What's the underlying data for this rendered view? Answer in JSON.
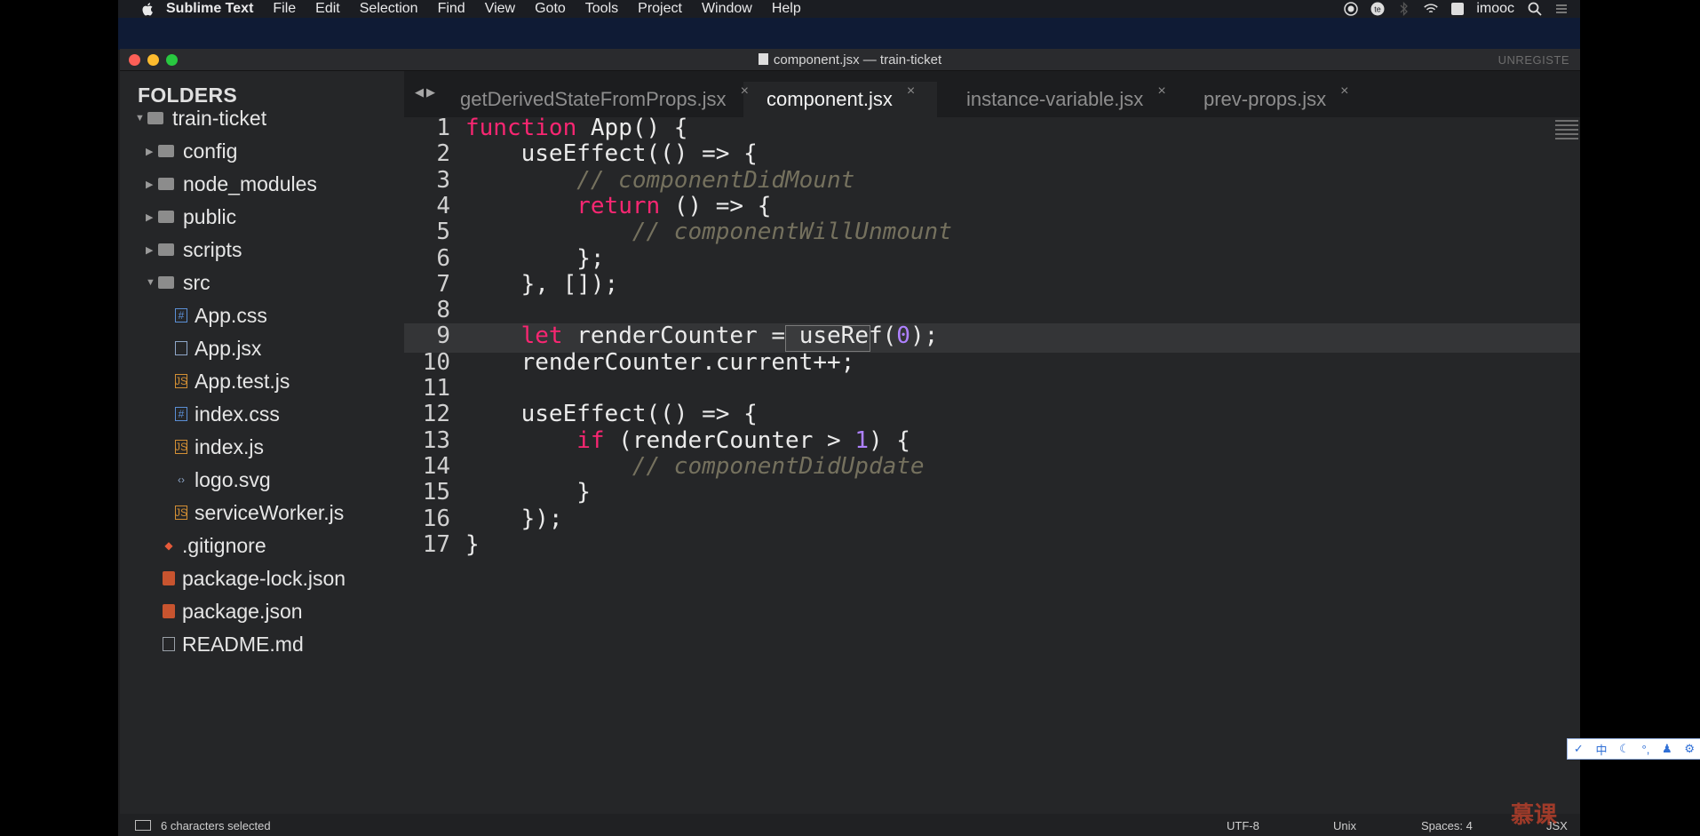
{
  "menubar": {
    "app_name": "Sublime Text",
    "items": [
      "File",
      "Edit",
      "Selection",
      "Find",
      "View",
      "Goto",
      "Tools",
      "Project",
      "Window",
      "Help"
    ],
    "user": "imooc",
    "input_badge": "A",
    "status_icons": [
      "record-icon",
      "te-icon",
      "bluetooth-icon",
      "wifi-icon",
      "input-source-icon",
      "spotlight-search-icon",
      "control-center-icon"
    ]
  },
  "window": {
    "title": "component.jsx — train-ticket",
    "unregistered": "UNREGISTE"
  },
  "sidebar": {
    "title": "FOLDERS",
    "tree": [
      {
        "label": "train-ticket",
        "kind": "folder",
        "expanded": true,
        "depth": 0
      },
      {
        "label": "config",
        "kind": "folder",
        "expanded": false,
        "depth": 1
      },
      {
        "label": "node_modules",
        "kind": "folder",
        "expanded": false,
        "depth": 1
      },
      {
        "label": "public",
        "kind": "folder",
        "expanded": false,
        "depth": 1
      },
      {
        "label": "scripts",
        "kind": "folder",
        "expanded": false,
        "depth": 1
      },
      {
        "label": "src",
        "kind": "folder",
        "expanded": true,
        "depth": 1
      },
      {
        "label": "App.css",
        "kind": "css",
        "depth": 2
      },
      {
        "label": "App.jsx",
        "kind": "jsx",
        "depth": 2
      },
      {
        "label": "App.test.js",
        "kind": "js",
        "depth": 2
      },
      {
        "label": "index.css",
        "kind": "css",
        "depth": 2
      },
      {
        "label": "index.js",
        "kind": "js",
        "depth": 2
      },
      {
        "label": "logo.svg",
        "kind": "svg",
        "depth": 2
      },
      {
        "label": "serviceWorker.js",
        "kind": "js",
        "depth": 2
      },
      {
        "label": ".gitignore",
        "kind": "git",
        "depth": 1
      },
      {
        "label": "package-lock.json",
        "kind": "json",
        "depth": 1
      },
      {
        "label": "package.json",
        "kind": "json",
        "depth": 1
      },
      {
        "label": "README.md",
        "kind": "md",
        "depth": 1
      }
    ]
  },
  "tabs": [
    {
      "label": "getDerivedStateFromProps.jsx",
      "active": false
    },
    {
      "label": "component.jsx",
      "active": true
    },
    {
      "label": "instance-variable.jsx",
      "active": false
    },
    {
      "label": "prev-props.jsx",
      "active": false
    }
  ],
  "editor": {
    "active_line": 9,
    "lines": [
      [
        {
          "t": "function",
          "c": "kw"
        },
        {
          "t": " App() {",
          "c": "pl"
        }
      ],
      [
        {
          "t": "    useEffect(() => {",
          "c": "pl"
        }
      ],
      [
        {
          "t": "        // componentDidMount",
          "c": "cm"
        }
      ],
      [
        {
          "t": "        ",
          "c": "pl"
        },
        {
          "t": "return",
          "c": "kw"
        },
        {
          "t": " () => {",
          "c": "pl"
        }
      ],
      [
        {
          "t": "            // componentWillUnmount",
          "c": "cm"
        }
      ],
      [
        {
          "t": "        };",
          "c": "pl"
        }
      ],
      [
        {
          "t": "    }, []);",
          "c": "pl"
        }
      ],
      [],
      [
        {
          "t": "    ",
          "c": "pl"
        },
        {
          "t": "let",
          "c": "kw"
        },
        {
          "t": " renderCounter = useRef(",
          "c": "pl"
        },
        {
          "t": "0",
          "c": "num"
        },
        {
          "t": ");",
          "c": "pl"
        }
      ],
      [
        {
          "t": "    renderCounter.current++;",
          "c": "pl"
        }
      ],
      [],
      [
        {
          "t": "    useEffect(() => {",
          "c": "pl"
        }
      ],
      [
        {
          "t": "        ",
          "c": "pl"
        },
        {
          "t": "if",
          "c": "kw"
        },
        {
          "t": " (renderCounter > ",
          "c": "pl"
        },
        {
          "t": "1",
          "c": "num"
        },
        {
          "t": ") {",
          "c": "pl"
        }
      ],
      [
        {
          "t": "            // componentDidUpdate",
          "c": "cm"
        }
      ],
      [
        {
          "t": "        }",
          "c": "pl"
        }
      ],
      [
        {
          "t": "    });",
          "c": "pl"
        }
      ],
      [
        {
          "t": "}",
          "c": "pl"
        }
      ]
    ]
  },
  "status": {
    "selection": "6 characters selected",
    "encoding": "UTF-8",
    "line_endings": "Unix",
    "indentation": "Spaces: 4",
    "syntax": "JSX"
  },
  "watermark": "慕课",
  "ime_toolbar": [
    "✓",
    "中",
    "☾",
    "°,",
    "♟",
    "⚙"
  ],
  "colors": {
    "keyword": "#f92672",
    "comment": "#75715e",
    "number": "#ae81ff",
    "plain": "#eaeaea"
  }
}
